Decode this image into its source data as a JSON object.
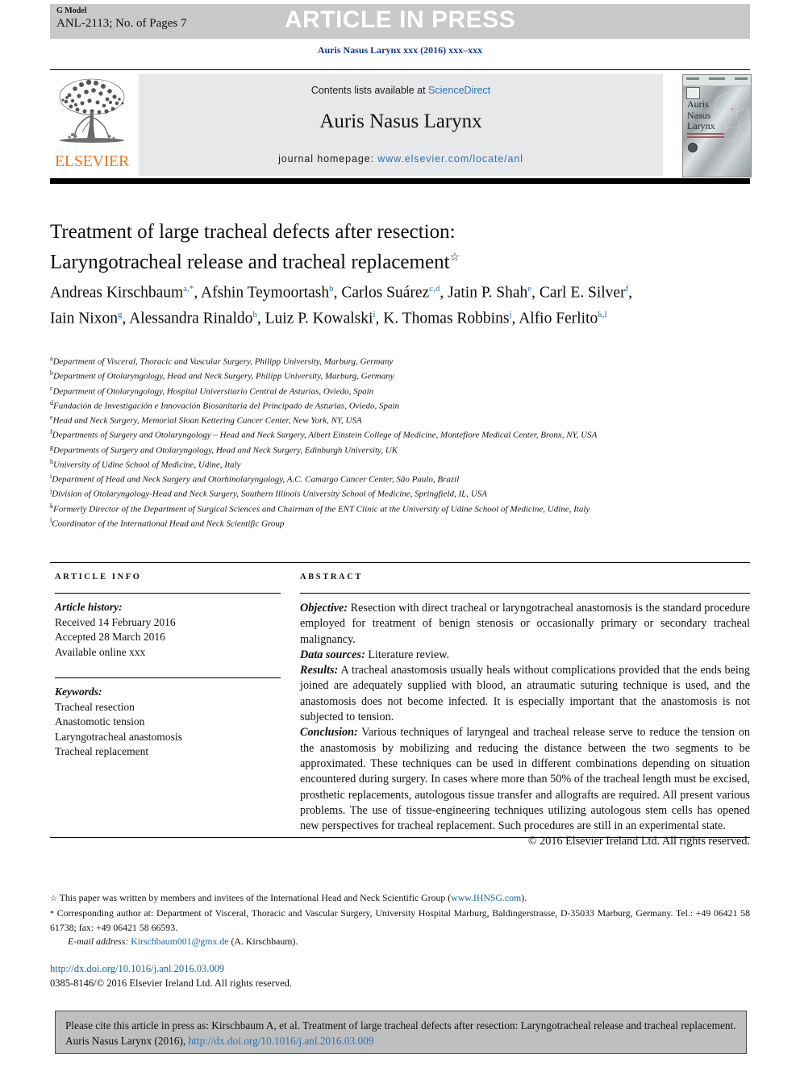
{
  "header": {
    "g_model": "G Model",
    "doc_id": "ANL-2113; No. of Pages 7",
    "article_in_press": "ARTICLE IN PRESS",
    "running_head": "Auris Nasus Larynx xxx (2016) xxx–xxx"
  },
  "masthead": {
    "contents_prefix": "Contents lists available at ",
    "sciencedirect": "ScienceDirect",
    "journal_name": "Auris Nasus Larynx",
    "homepage_prefix": "journal homepage: ",
    "homepage_url": "www.elsevier.com/locate/anl",
    "publisher": "ELSEVIER",
    "cover_title_line1": "Auris",
    "cover_title_line2": "Nasus",
    "cover_title_line3": "Larynx"
  },
  "article": {
    "title_line1": "Treatment of large tracheal defects after resection:",
    "title_line2": "Laryngotracheal release and tracheal replacement",
    "title_footnote_mark": "☆",
    "authors_html": "Andreas Kirschbaum<sup>a,*</sup>, Afshin Teymoortash<sup>b</sup>, Carlos Suárez<sup>c,d</sup>, Jatin P. Shah<sup>e</sup>, Carl E. Silver<sup>f</sup>, Iain Nixon<sup>g</sup>, Alessandra Rinaldo<sup>h</sup>, Luiz P. Kowalski<sup>i</sup>, K. Thomas Robbins<sup>j</sup>, Alfio Ferlito<sup>k,l</sup>",
    "affiliations": [
      {
        "mark": "a",
        "text": "Department of Visceral, Thoracic and Vascular Surgery, Philipp University, Marburg, Germany"
      },
      {
        "mark": "b",
        "text": "Department of Otolaryngology, Head and Neck Surgery, Philipp University, Marburg, Germany"
      },
      {
        "mark": "c",
        "text": "Department of Otolaryngology, Hospital Universitario Central de Asturias, Oviedo, Spain"
      },
      {
        "mark": "d",
        "text": "Fundación de Investigación e Innovación Biosanitaria del Principado de Asturias, Oviedo, Spain"
      },
      {
        "mark": "e",
        "text": "Head and Neck Surgery, Memorial Sloan Kettering Cancer Center, New York, NY, USA"
      },
      {
        "mark": "f",
        "text": "Departments of Surgery and Otolaryngology – Head and Neck Surgery, Albert Einstein College of Medicine, Montefiore Medical Center, Bronx, NY, USA"
      },
      {
        "mark": "g",
        "text": "Departments of Surgery and Otolaryngology, Head and Neck Surgery, Edinburgh University, UK"
      },
      {
        "mark": "h",
        "text": "University of Udine School of Medicine, Udine, Italy"
      },
      {
        "mark": "i",
        "text": "Department of Head and Neck Surgery and Otorhinolaryngology, A.C. Camargo Cancer Center, São Paulo, Brazil"
      },
      {
        "mark": "j",
        "text": "Division of Otolaryngology-Head and Neck Surgery, Southern Illinois University School of Medicine, Springfield, IL, USA"
      },
      {
        "mark": "k",
        "text": "Formerly Director of the Department of Surgical Sciences and Chairman of the ENT Clinic at the University of Udine School of Medicine, Udine, Italy"
      },
      {
        "mark": "l",
        "text": "Coordinator of the International Head and Neck Scientific Group"
      }
    ]
  },
  "article_info": {
    "heading": "ARTICLE INFO",
    "history_title": "Article history:",
    "history": [
      "Received 14 February 2016",
      "Accepted 28 March 2016",
      "Available online xxx"
    ],
    "keywords_title": "Keywords:",
    "keywords": [
      "Tracheal resection",
      "Anastomotic tension",
      "Laryngotracheal anastomosis",
      "Tracheal replacement"
    ]
  },
  "abstract": {
    "heading": "ABSTRACT",
    "sections": [
      {
        "label": "Objective:",
        "text": " Resection with direct tracheal or laryngotracheal anastomosis is the standard procedure employed for treatment of benign stenosis or occasionally primary or secondary tracheal malignancy."
      },
      {
        "label": "Data sources:",
        "text": " Literature review."
      },
      {
        "label": "Results:",
        "text": " A tracheal anastomosis usually heals without complications provided that the ends being joined are adequately supplied with blood, an atraumatic suturing technique is used, and the anastomosis does not become infected. It is especially important that the anastomosis is not subjected to tension."
      },
      {
        "label": "Conclusion:",
        "text": " Various techniques of laryngeal and tracheal release serve to reduce the tension on the anastomosis by mobilizing and reducing the distance between the two segments to be approximated. These techniques can be used in different combinations depending on situation encountered during surgery. In cases where more than 50% of the tracheal length must be excised, prosthetic replacements, autologous tissue transfer and allografts are required. All present various problems. The use of tissue-engineering techniques utilizing autologous stem cells has opened new perspectives for tracheal replacement. Such procedures are still in an experimental state."
      }
    ],
    "copyright": "© 2016 Elsevier Ireland Ltd. All rights reserved."
  },
  "footnotes": {
    "star_mark": "☆",
    "star_text_prefix": " This paper was written by members and invitees of the International Head and Neck Scientific Group (",
    "star_link": "www.IHNSG.com",
    "star_text_suffix": ").",
    "corr_mark": "*",
    "corr_text": " Corresponding author at: Department of Visceral, Thoracic and Vascular Surgery, University Hospital Marburg, Baldingerstrasse, D-35033 Marburg, Germany. Tel.: +49 06421 58 61738; fax: +49 06421 58 66593.",
    "email_label": "E-mail address:",
    "email_link": "Kirschbaum001@gmx.de",
    "email_suffix": " (A. Kirschbaum).",
    "doi_url": "http://dx.doi.org/10.1016/j.anl.2016.03.009",
    "issn_line": "0385-8146/© 2016 Elsevier Ireland Ltd. All rights reserved."
  },
  "cite_box": {
    "text": "Please cite this article in press as: Kirschbaum A, et al. Treatment of large tracheal defects after resection: Laryngotracheal release and tracheal replacement. Auris Nasus Larynx (2016), ",
    "link": "http://dx.doi.org/10.1016/j.anl.2016.03.009"
  },
  "colors": {
    "link_blue": "#2a72b5",
    "running_head_blue": "#113a8c",
    "elsevier_orange": "#e87722",
    "band_grey": "#c9c9c9",
    "masthead_grey": "#e7e8ea",
    "cite_box_grey": "#bfbfbf"
  }
}
